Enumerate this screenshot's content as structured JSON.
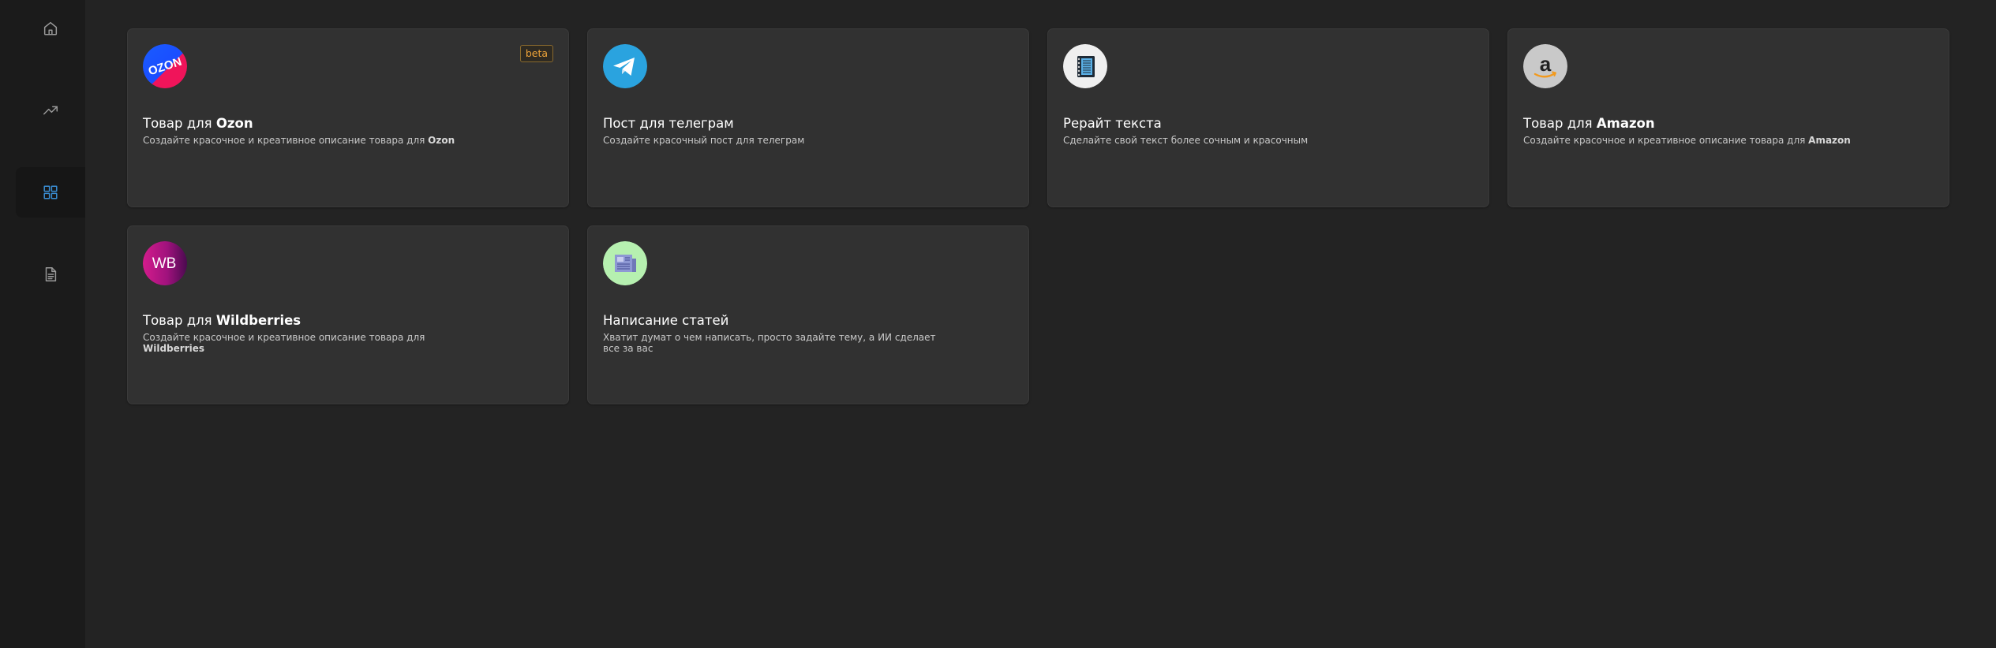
{
  "sidebar": {
    "items": [
      {
        "name": "home",
        "icon": "home-icon",
        "active": false
      },
      {
        "name": "trending",
        "icon": "trending-up-icon",
        "active": false
      },
      {
        "name": "apps",
        "icon": "grid-icon",
        "active": true
      },
      {
        "name": "documents",
        "icon": "document-icon",
        "active": false
      }
    ],
    "active_color": "#3a8fd6"
  },
  "cards": [
    {
      "id": "ozon",
      "icon": "ozon-logo-icon",
      "icon_text": "OZON",
      "title_prefix": "Товар для ",
      "title_bold": "Ozon",
      "desc_prefix": "Создайте красочное и креативное описание товара для ",
      "desc_bold": "Ozon",
      "badge": "beta"
    },
    {
      "id": "telegram",
      "icon": "telegram-icon",
      "title_prefix": "Пост для телеграм",
      "title_bold": "",
      "desc_prefix": "Создайте красочный пост для телеграм",
      "desc_bold": ""
    },
    {
      "id": "rewrite",
      "icon": "notebook-icon",
      "title_prefix": "Рерайт текста",
      "title_bold": "",
      "desc_prefix": "Сделайте свой текст более сочным и красочным",
      "desc_bold": ""
    },
    {
      "id": "amazon",
      "icon": "amazon-logo-icon",
      "icon_text": "a",
      "title_prefix": "Товар для ",
      "title_bold": "Amazon",
      "desc_prefix": "Создайте красочное и креативное описание товара для ",
      "desc_bold": "Amazon"
    },
    {
      "id": "wildberries",
      "icon": "wildberries-logo-icon",
      "icon_text": "WB",
      "title_prefix": "Товар для ",
      "title_bold": "Wildberries",
      "desc_prefix": "Создайте красочное и креативное описание товара для ",
      "desc_bold": "Wildberries"
    },
    {
      "id": "articles",
      "icon": "newspaper-icon",
      "title_prefix": "Написание статей",
      "title_bold": "",
      "desc_prefix": "Хватит думат о чем написать, просто задайте тему, а ИИ сделает все за вас",
      "desc_bold": ""
    }
  ]
}
